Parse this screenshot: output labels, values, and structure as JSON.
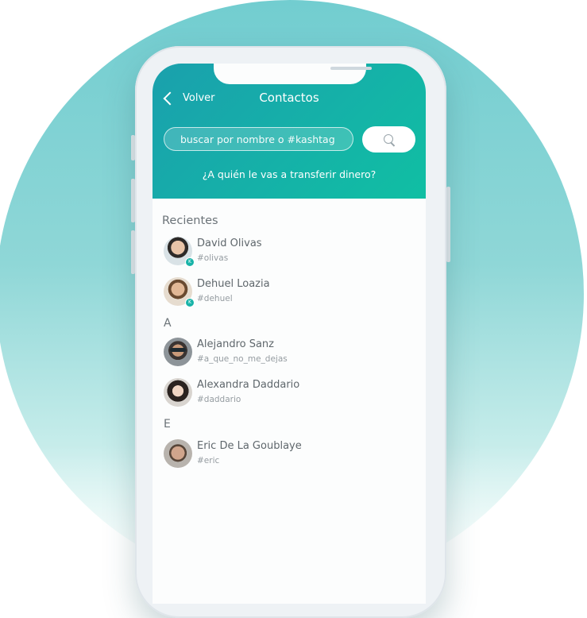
{
  "header": {
    "back_label": "Volver",
    "title": "Contactos",
    "search_placeholder": "buscar por nombre o #kashtag",
    "subtitle": "¿A quién le vas a transferir dinero?"
  },
  "sections": {
    "recent_label": "Recientes",
    "letter_a": "A",
    "letter_e": "E"
  },
  "contacts": [
    {
      "name": "David Olivas",
      "tag": "#olivas",
      "badge": "K"
    },
    {
      "name": "Dehuel Loazia",
      "tag": "#dehuel",
      "badge": "K"
    },
    {
      "name": "Alejandro Sanz",
      "tag": "#a_que_no_me_dejas"
    },
    {
      "name": "Alexandra Daddario",
      "tag": "#daddario"
    },
    {
      "name": "Eric De La Goublaye",
      "tag": "#eric"
    }
  ],
  "icons": {
    "back": "chevron-left-icon",
    "search": "search-icon"
  },
  "colors": {
    "header_start": "#1aa0ad",
    "header_end": "#10bfa3",
    "badge": "#19b3a8",
    "background_circle": "#72cdd0"
  }
}
